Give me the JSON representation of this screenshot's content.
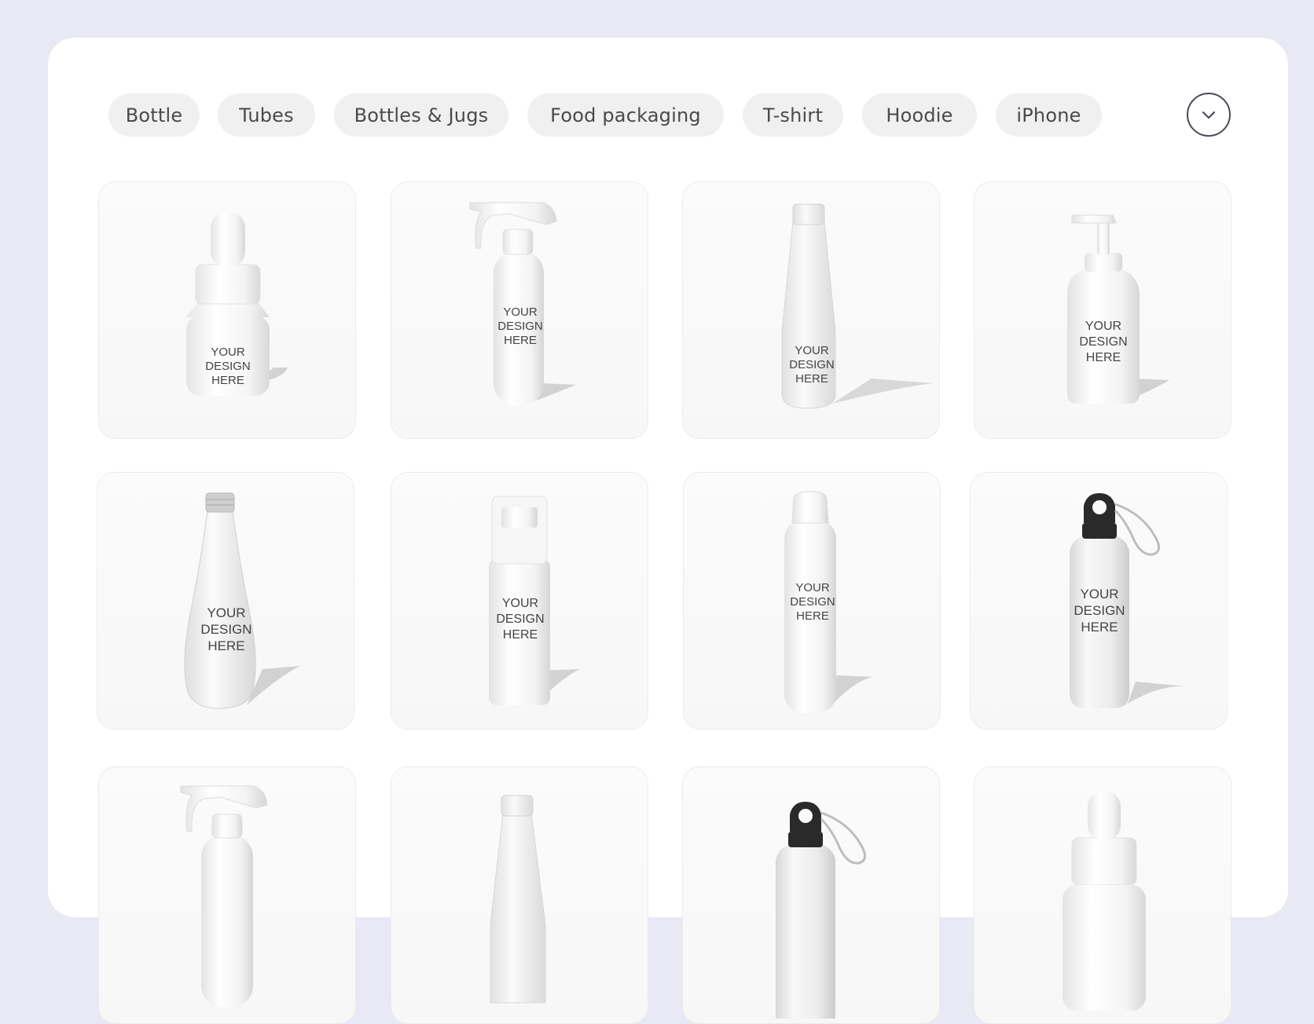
{
  "filters": {
    "chips": [
      {
        "label": "Bottle"
      },
      {
        "label": "Tubes"
      },
      {
        "label": "Bottles & Jugs"
      },
      {
        "label": "Food packaging"
      },
      {
        "label": "T-shirt"
      },
      {
        "label": "Hoodie"
      },
      {
        "label": "iPhone"
      }
    ],
    "expand_icon": "chevron-down-icon"
  },
  "mockup_text": {
    "line1": "YOUR",
    "line2": "DESIGN",
    "line3": "HERE"
  },
  "grid": {
    "items": [
      {
        "product": "dropper-bottle"
      },
      {
        "product": "spray-bottle"
      },
      {
        "product": "clear-plastic-bottle"
      },
      {
        "product": "pump-bottle"
      },
      {
        "product": "glass-bottle"
      },
      {
        "product": "foam-pump-bottle"
      },
      {
        "product": "flip-cap-bottle"
      },
      {
        "product": "aluminum-water-bottle"
      },
      {
        "product": "spray-bottle"
      },
      {
        "product": "clear-plastic-bottle"
      },
      {
        "product": "aluminum-water-bottle"
      },
      {
        "product": "dropper-bottle"
      }
    ]
  },
  "colors": {
    "background": "#e8e9f4",
    "panel": "#ffffff",
    "chip": "#f0f0f0",
    "chip_text": "#4a4a4a"
  }
}
